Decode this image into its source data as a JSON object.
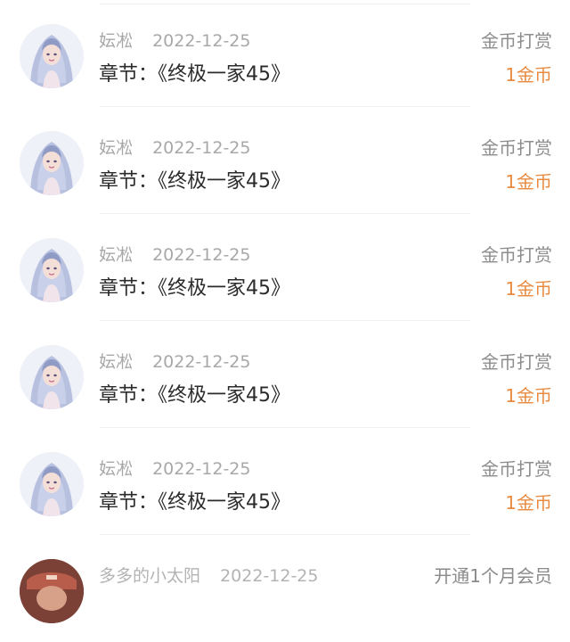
{
  "rewards": [
    {
      "user": "妘凇",
      "date": "2022-12-25",
      "chapter": "章节：《终极一家45》",
      "type": "金币打赏",
      "amount": "1金币"
    },
    {
      "user": "妘凇",
      "date": "2022-12-25",
      "chapter": "章节：《终极一家45》",
      "type": "金币打赏",
      "amount": "1金币"
    },
    {
      "user": "妘凇",
      "date": "2022-12-25",
      "chapter": "章节：《终极一家45》",
      "type": "金币打赏",
      "amount": "1金币"
    },
    {
      "user": "妘凇",
      "date": "2022-12-25",
      "chapter": "章节：《终极一家45》",
      "type": "金币打赏",
      "amount": "1金币"
    },
    {
      "user": "妘凇",
      "date": "2022-12-25",
      "chapter": "章节：《终极一家45》",
      "type": "金币打赏",
      "amount": "1金币"
    },
    {
      "user": "多多的小太阳",
      "date": "2022-12-25",
      "type": "开通1个月会员"
    }
  ]
}
